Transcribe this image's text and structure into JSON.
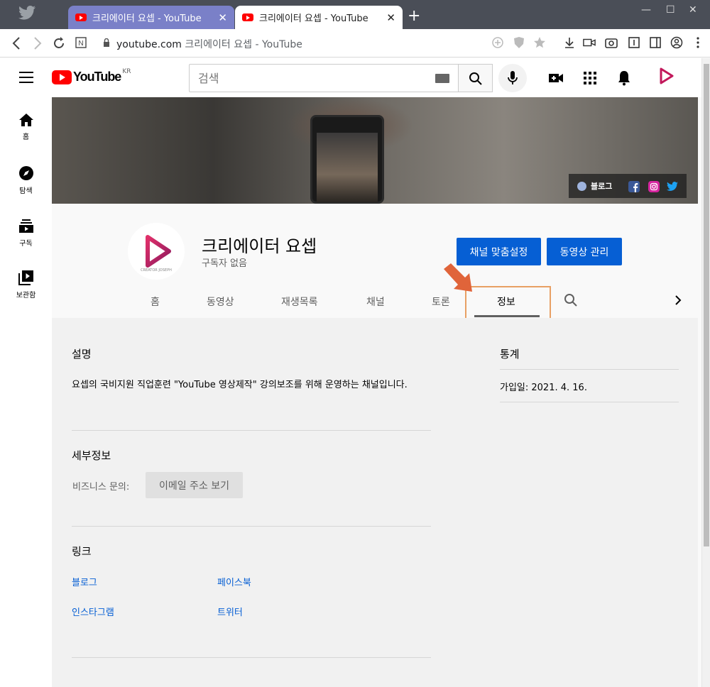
{
  "browser": {
    "tabs": [
      {
        "title": "크리에이터 요셉 - YouTube",
        "active": false
      },
      {
        "title": "크리에이터 요셉 - YouTube",
        "active": true
      }
    ],
    "url_host": "youtube.com",
    "url_title": " 크리에이터 요셉 - YouTube"
  },
  "header": {
    "logo_text": "YouTube",
    "region": "KR",
    "search_placeholder": "검색"
  },
  "sidebar": {
    "items": [
      {
        "label": "홈",
        "icon": "home-icon"
      },
      {
        "label": "탐색",
        "icon": "compass-icon"
      },
      {
        "label": "구독",
        "icon": "subscriptions-icon"
      },
      {
        "label": "보관함",
        "icon": "library-icon"
      }
    ]
  },
  "banner": {
    "blog_label": "블로그"
  },
  "channel": {
    "name": "크리에이터 요셉",
    "subscribers": "구독자 없음",
    "customize_label": "채널 맞춤설정",
    "manage_label": "동영상 관리",
    "avatar_caption": "CREATOR JOSEPH",
    "tabs": [
      "홈",
      "동영상",
      "재생목록",
      "채널",
      "토론",
      "정보"
    ],
    "active_tab": "정보"
  },
  "about": {
    "description_title": "설명",
    "description": "요셉의 국비지원 직업훈련 \"YouTube 영상제작\" 강의보조를 위해 운영하는 채널입니다.",
    "details_title": "세부정보",
    "business_label": "비즈니스 문의:",
    "email_button": "이메일 주소 보기",
    "links_title": "링크",
    "links": [
      "블로그",
      "페이스북",
      "인스타그램",
      "트위터"
    ],
    "stats_title": "통계",
    "joined": "가입일: 2021. 4. 16."
  },
  "colors": {
    "accent_blue": "#065fd4",
    "youtube_red": "#ff0000",
    "highlight_orange": "#e8a064",
    "arrow_orange": "#e0643a",
    "brand_magenta": "#c2185b"
  }
}
